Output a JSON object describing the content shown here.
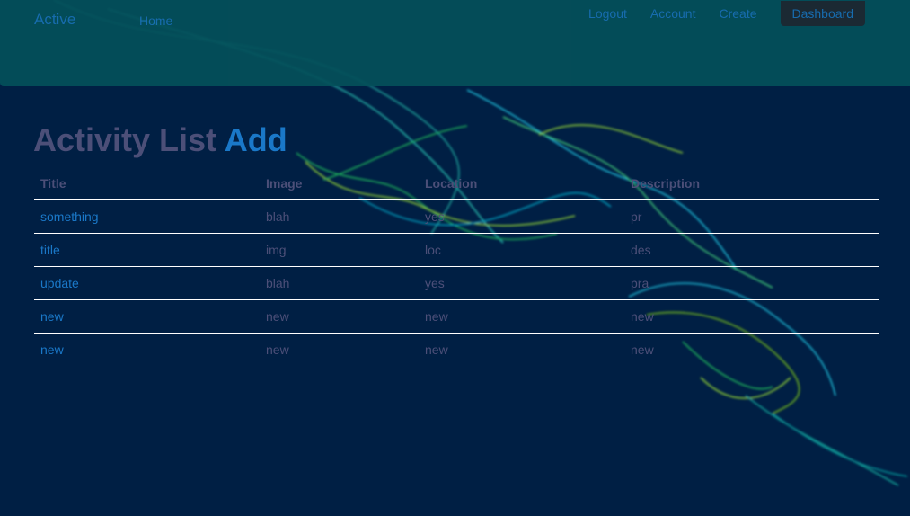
{
  "navbar": {
    "brand": "Active",
    "home": "Home",
    "links": [
      "Logout",
      "Account",
      "Create",
      "Dashboard"
    ],
    "active_link": "Dashboard"
  },
  "page": {
    "title": "Activity List",
    "add_label": "Add"
  },
  "table": {
    "headers": [
      "Title",
      "Image",
      "Location",
      "Description"
    ],
    "rows": [
      [
        "something",
        "blah",
        "yes",
        "pr"
      ],
      [
        "title",
        "img",
        "loc",
        "des"
      ],
      [
        "update",
        "blah",
        "yes",
        "pra"
      ],
      [
        "new",
        "new",
        "new",
        "new"
      ],
      [
        "new",
        "new",
        "new",
        "new"
      ]
    ]
  },
  "colors": {
    "background": "#001f44",
    "navbar": "#04505a",
    "link": "#1a78c8",
    "muted_text": "#4c4f78"
  }
}
